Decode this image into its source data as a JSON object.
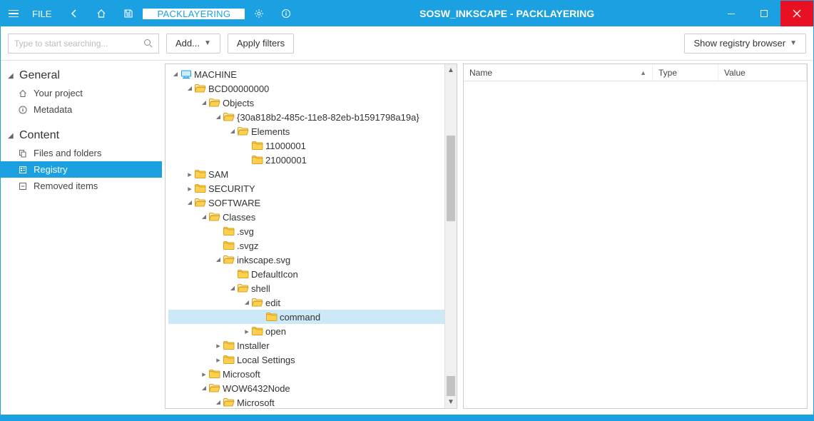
{
  "titlebar": {
    "file_label": "FILE",
    "tab_label": "PACKLAYERING",
    "window_title": "SOSW_INKSCAPE - PACKLAYERING"
  },
  "toolbar": {
    "search_placeholder": "Type to start searching...",
    "add_label": "Add...",
    "apply_label": "Apply filters",
    "registry_label": "Show registry browser"
  },
  "sidebar": {
    "groups": [
      {
        "title": "General",
        "items": [
          "Your project",
          "Metadata"
        ]
      },
      {
        "title": "Content",
        "items": [
          "Files and folders",
          "Registry",
          "Removed items"
        ]
      }
    ]
  },
  "columns": {
    "name": "Name",
    "type": "Type",
    "value": "Value"
  },
  "tree": [
    {
      "d": 0,
      "e": "open",
      "ic": "computer",
      "t": "MACHINE"
    },
    {
      "d": 1,
      "e": "open",
      "ic": "fo",
      "t": "BCD00000000"
    },
    {
      "d": 2,
      "e": "open",
      "ic": "fo",
      "t": "Objects"
    },
    {
      "d": 3,
      "e": "open",
      "ic": "fo",
      "t": "{30a818b2-485c-11e8-82eb-b1591798a19a}"
    },
    {
      "d": 4,
      "e": "open",
      "ic": "fo",
      "t": "Elements"
    },
    {
      "d": 5,
      "e": "none",
      "ic": "fc",
      "t": "11000001"
    },
    {
      "d": 5,
      "e": "none",
      "ic": "fc",
      "t": "21000001"
    },
    {
      "d": 1,
      "e": "closed",
      "ic": "fc",
      "t": "SAM"
    },
    {
      "d": 1,
      "e": "closed",
      "ic": "fc",
      "t": "SECURITY"
    },
    {
      "d": 1,
      "e": "open",
      "ic": "fo",
      "t": "SOFTWARE"
    },
    {
      "d": 2,
      "e": "open",
      "ic": "fo",
      "t": "Classes"
    },
    {
      "d": 3,
      "e": "none",
      "ic": "fc",
      "t": ".svg"
    },
    {
      "d": 3,
      "e": "none",
      "ic": "fc",
      "t": ".svgz"
    },
    {
      "d": 3,
      "e": "open",
      "ic": "fo",
      "t": "inkscape.svg"
    },
    {
      "d": 4,
      "e": "none",
      "ic": "fc",
      "t": "DefaultIcon"
    },
    {
      "d": 4,
      "e": "open",
      "ic": "fo",
      "t": "shell"
    },
    {
      "d": 5,
      "e": "open",
      "ic": "fo",
      "t": "edit"
    },
    {
      "d": 6,
      "e": "none",
      "ic": "fc",
      "t": "command",
      "sel": true
    },
    {
      "d": 5,
      "e": "closed",
      "ic": "fc",
      "t": "open"
    },
    {
      "d": 3,
      "e": "closed",
      "ic": "fc",
      "t": "Installer"
    },
    {
      "d": 3,
      "e": "closed",
      "ic": "fc",
      "t": "Local Settings"
    },
    {
      "d": 2,
      "e": "closed",
      "ic": "fc",
      "t": "Microsoft"
    },
    {
      "d": 2,
      "e": "open",
      "ic": "fo",
      "t": "WOW6432Node"
    },
    {
      "d": 3,
      "e": "open",
      "ic": "fo",
      "t": "Microsoft"
    }
  ]
}
